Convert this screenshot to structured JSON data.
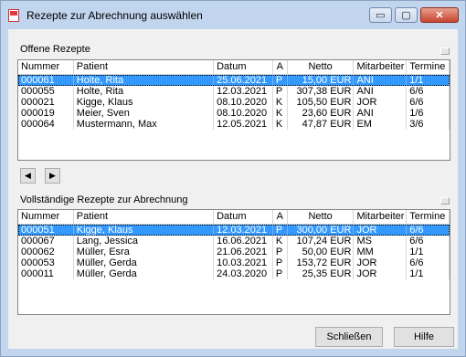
{
  "window": {
    "title": "Rezepte zur Abrechnung auswählen"
  },
  "titlebar_buttons": {
    "minimize": "▭",
    "maximize": "▢",
    "close": "✕"
  },
  "open_section": {
    "label": "Offene Rezepte",
    "columns": [
      "Nummer",
      "Patient",
      "Datum",
      "A",
      "Netto",
      "Mitarbeiter",
      "Termine"
    ],
    "rows": [
      [
        "000061",
        "Holte, Rita",
        "25.06.2021",
        "P",
        "15,00 EUR",
        "ANI",
        "1/1"
      ],
      [
        "000055",
        "Holte, Rita",
        "12.03.2021",
        "P",
        "307,38 EUR",
        "ANI",
        "6/6"
      ],
      [
        "000021",
        "Kigge, Klaus",
        "08.10.2020",
        "K",
        "105,50 EUR",
        "JOR",
        "6/6"
      ],
      [
        "000019",
        "Meier, Sven",
        "08.10.2020",
        "K",
        "23,60 EUR",
        "ANI",
        "1/6"
      ],
      [
        "000064",
        "Mustermann, Max",
        "12.05.2021",
        "K",
        "47,87 EUR",
        "EM",
        "3/6"
      ]
    ],
    "selected_index": 0
  },
  "nav": {
    "left": "◀",
    "right": "▶"
  },
  "complete_section": {
    "label": "Vollständige Rezepte zur Abrechnung",
    "columns": [
      "Nummer",
      "Patient",
      "Datum",
      "A",
      "Netto",
      "Mitarbeiter",
      "Termine"
    ],
    "rows": [
      [
        "000051",
        "Kigge, Klaus",
        "12.03.2021",
        "P",
        "300,00 EUR",
        "JOR",
        "6/6"
      ],
      [
        "000067",
        "Lang, Jessica",
        "16.06.2021",
        "K",
        "107,24 EUR",
        "MS",
        "6/6"
      ],
      [
        "000062",
        "Müller, Esra",
        "21.06.2021",
        "P",
        "50,00 EUR",
        "MM",
        "1/1"
      ],
      [
        "000053",
        "Müller, Gerda",
        "10.03.2021",
        "P",
        "153,72 EUR",
        "JOR",
        "6/6"
      ],
      [
        "000011",
        "Müller, Gerda",
        "24.03.2020",
        "P",
        "25,35 EUR",
        "JOR",
        "1/1"
      ]
    ],
    "selected_index": 0
  },
  "buttons": {
    "close": "Schließen",
    "help": "Hilfe"
  }
}
